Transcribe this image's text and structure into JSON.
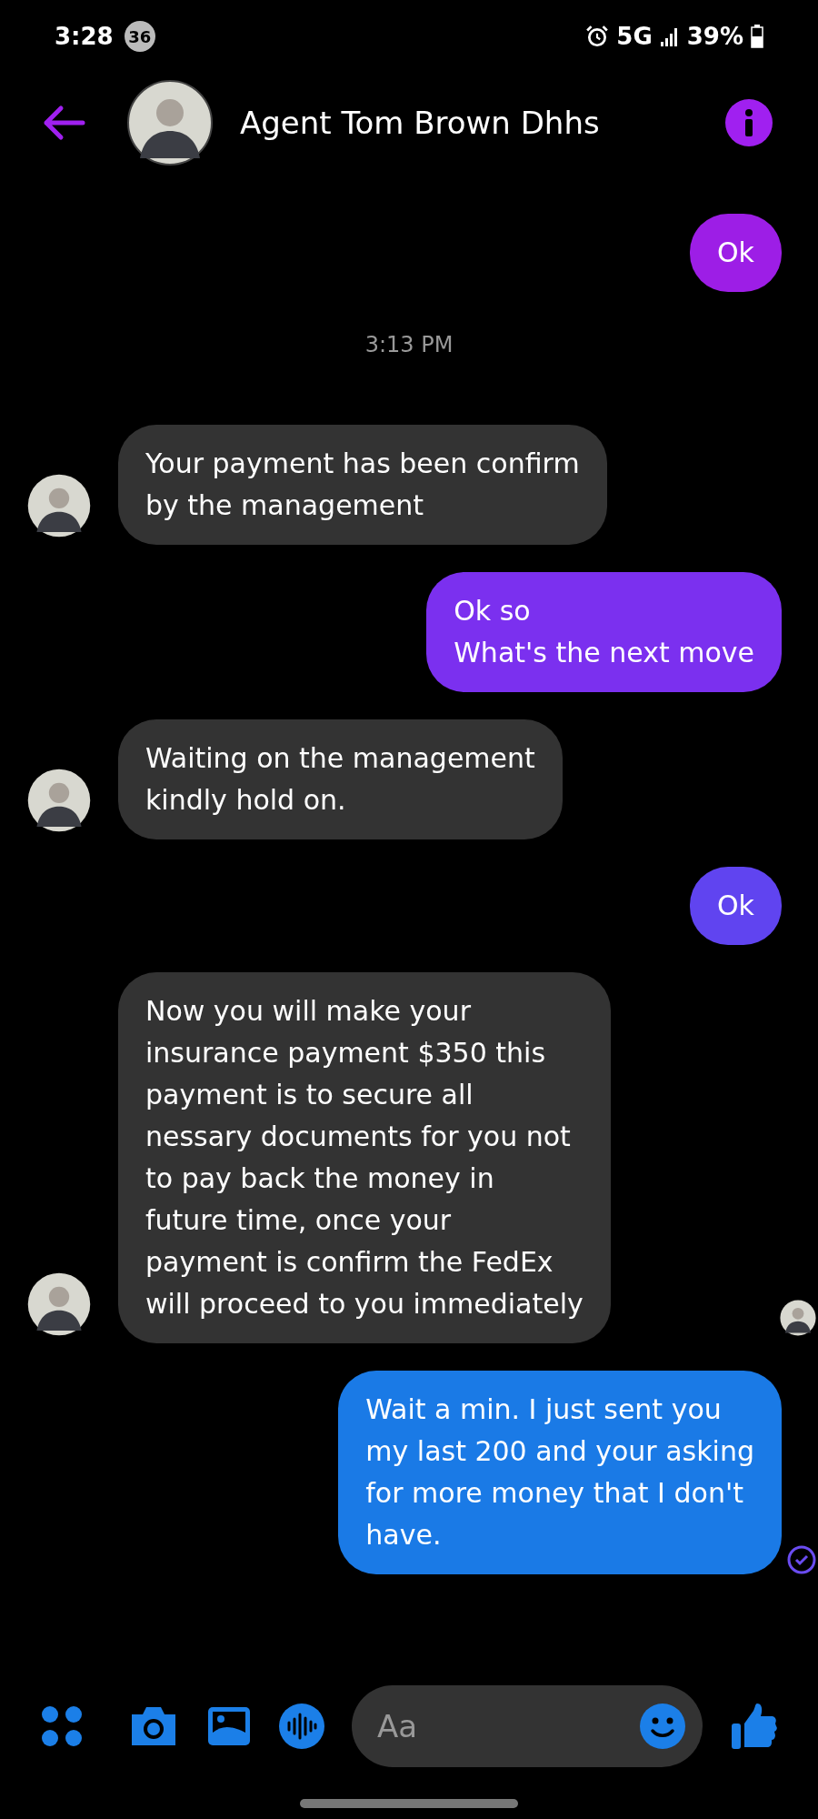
{
  "status_bar": {
    "time": "3:28",
    "notification_count": "36",
    "network": "5G",
    "battery": "39%"
  },
  "header": {
    "contact_name": "Agent Tom Brown Dhhs"
  },
  "messages": [
    {
      "kind": "sent",
      "lines": [
        "Ok"
      ],
      "color": "#9d1ee6"
    },
    {
      "kind": "time",
      "lines": [
        "3:13 PM"
      ]
    },
    {
      "kind": "received",
      "lines": [
        "Your payment has been confirm",
        "by the management"
      ]
    },
    {
      "kind": "sent",
      "lines": [
        "Ok so",
        "What's the next move"
      ],
      "color": "#7b30ef"
    },
    {
      "kind": "received",
      "lines": [
        "Waiting on the management",
        "kindly hold on."
      ]
    },
    {
      "kind": "sent",
      "lines": [
        "Ok"
      ],
      "color": "#6044f0"
    },
    {
      "kind": "received",
      "lines": [
        "Now you will make your",
        "insurance payment $350 this",
        "payment is to secure all",
        "nessary documents for you not",
        "to pay back the money in",
        "future time, once your",
        "payment is confirm the FedEx",
        "will proceed to you immediately"
      ],
      "seen": true
    },
    {
      "kind": "sent",
      "lines": [
        "Wait a min. I just sent you",
        "my last 200 and your asking",
        "for more money that I don't",
        "have."
      ],
      "color": "#1a7ae6",
      "delivered": true
    }
  ],
  "composer": {
    "placeholder": "Aa"
  }
}
